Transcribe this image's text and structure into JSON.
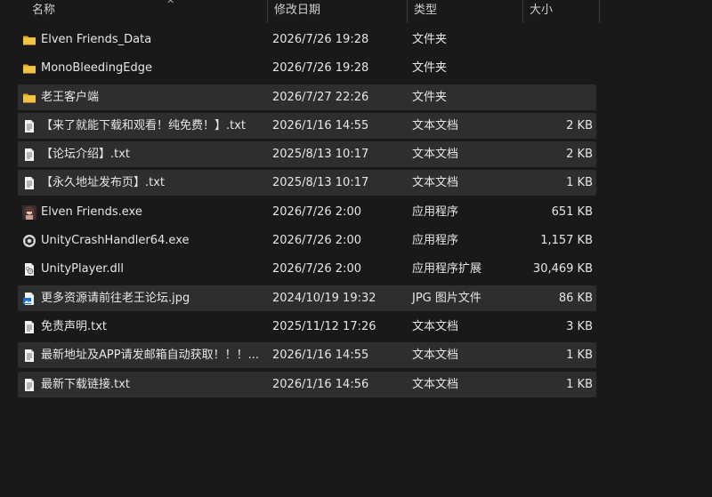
{
  "header": {
    "name": "名称",
    "date": "修改日期",
    "type": "类型",
    "size": "大小",
    "sort_arrow": "^"
  },
  "files": [
    {
      "name": "Elven Friends_Data",
      "date": "2026/7/26 19:28",
      "type": "文件夹",
      "size": "",
      "icon": "folder-icon",
      "selected": false
    },
    {
      "name": "MonoBleedingEdge",
      "date": "2026/7/26 19:28",
      "type": "文件夹",
      "size": "",
      "icon": "folder-icon",
      "selected": false
    },
    {
      "name": "老王客户端",
      "date": "2026/7/27 22:26",
      "type": "文件夹",
      "size": "",
      "icon": "folder-icon",
      "selected": true
    },
    {
      "name": "【来了就能下载和观看！纯免费！】.txt",
      "date": "2026/1/16 14:55",
      "type": "文本文档",
      "size": "2 KB",
      "icon": "text-file-icon",
      "selected": true
    },
    {
      "name": "【论坛介绍】.txt",
      "date": "2025/8/13 10:17",
      "type": "文本文档",
      "size": "2 KB",
      "icon": "text-file-icon",
      "selected": true
    },
    {
      "name": "【永久地址发布页】.txt",
      "date": "2025/8/13 10:17",
      "type": "文本文档",
      "size": "1 KB",
      "icon": "text-file-icon",
      "selected": true
    },
    {
      "name": "Elven Friends.exe",
      "date": "2026/7/26 2:00",
      "type": "应用程序",
      "size": "651 KB",
      "icon": "app-exe-icon",
      "selected": false
    },
    {
      "name": "UnityCrashHandler64.exe",
      "date": "2026/7/26 2:00",
      "type": "应用程序",
      "size": "1,157 KB",
      "icon": "unity-exe-icon",
      "selected": false
    },
    {
      "name": "UnityPlayer.dll",
      "date": "2026/7/26 2:00",
      "type": "应用程序扩展",
      "size": "30,469 KB",
      "icon": "dll-file-icon",
      "selected": false
    },
    {
      "name": "更多资源请前往老王论坛.jpg",
      "date": "2024/10/19 19:32",
      "type": "JPG 图片文件",
      "size": "86 KB",
      "icon": "image-file-icon",
      "selected": true
    },
    {
      "name": "免责声明.txt",
      "date": "2025/11/12 17:26",
      "type": "文本文档",
      "size": "3 KB",
      "icon": "text-file-icon",
      "selected": false
    },
    {
      "name": "最新地址及APP请发邮箱自动获取！！！...",
      "date": "2026/1/16 14:55",
      "type": "文本文档",
      "size": "1 KB",
      "icon": "text-file-icon",
      "selected": true
    },
    {
      "name": "最新下载链接.txt",
      "date": "2026/1/16 14:56",
      "type": "文本文档",
      "size": "1 KB",
      "icon": "text-file-icon",
      "selected": true
    }
  ],
  "colors": {
    "background": "#191919",
    "selected_row": "#2e2e2e",
    "folder": "#f4c245",
    "text": "#e6e6e6"
  }
}
